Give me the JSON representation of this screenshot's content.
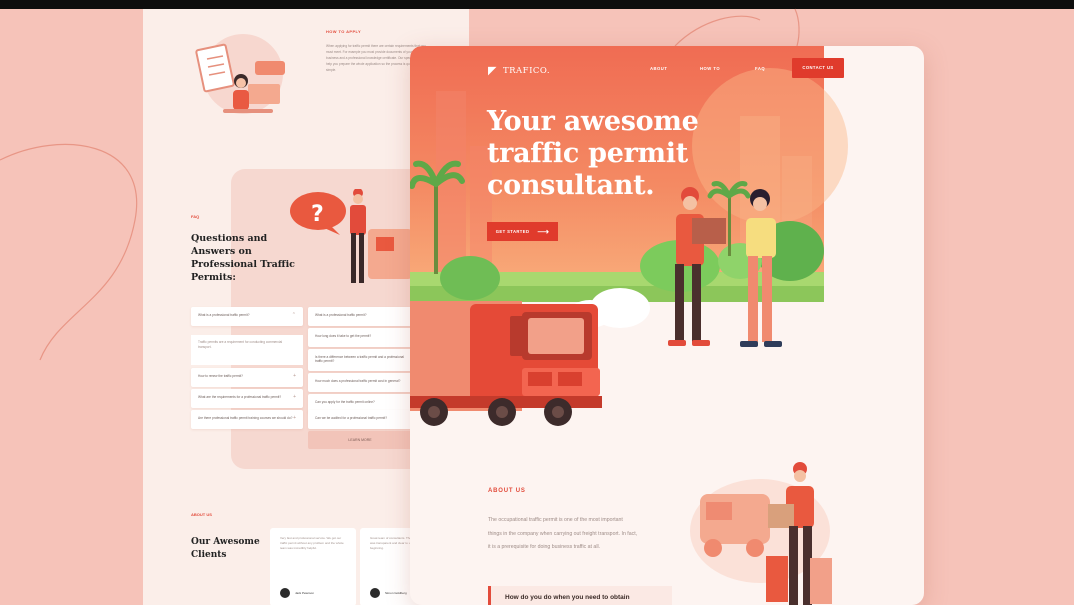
{
  "colors": {
    "accent": "#e03b2c",
    "hero_top": "#f06c53",
    "hero_bottom": "#f9b07d",
    "background": "#f6c3b9"
  },
  "back_page": {
    "howto_title": "HOW TO APPLY",
    "howto_text": "When applying for traffic permit there are certain requirements that you must meet. For example you must provide documents of your business and a professional knowledge certificate. Our specialists will help you prepare the whole application so the process is quick and simple.",
    "faq_tag": "FAQ",
    "faq_title": "Questions and Answers on Professional Traffic Permits:",
    "faq_questions_left": [
      "What is a professional traffic permit?",
      "How to renew the traffic permit?",
      "What are the requirements for a professional traffic permit?",
      "Are there professional traffic permit training courses we should do?"
    ],
    "faq_answer": "Traffic permits are a requirement for conducting commercial transport.",
    "faq_questions_right": [
      "What is a professional traffic permit?",
      "How long does it take to get the permit?",
      "Is there a difference between a traffic permit and a professional traffic permit?",
      "How much does a professional traffic permit cost in general?",
      "Can you apply for the traffic permit online?",
      "Can we be audited for a professional traffic permit?"
    ],
    "learn_more": "LEARN MORE",
    "about_tag": "ABOUT US",
    "clients_title": "Our Awesome Clients",
    "clients": [
      {
        "quote": "Very fast and professional service. We got our traffic permit without any problem and the whole team was incredibly helpful.",
        "name": "Jack Peterson"
      },
      {
        "quote": "Great team of consultants. The whole process was transparent and clear to us from the very beginning.",
        "name": "Simon Goldberg"
      }
    ]
  },
  "front_page": {
    "logo_mark": "◤",
    "logo_text": "TRAFICO.",
    "nav": [
      "ABOUT",
      "HOW TO",
      "FAQ"
    ],
    "contact_button": "CONTACT US",
    "hero_title": "Your awesome traffic permit consultant.",
    "cta_label": "GET STARTED",
    "cta_arrow": "⟶",
    "about_tag": "ABOUT US",
    "about_text": "The occupational traffic permit is one of the most important things in the company when carrying out freight transport. In fact, it is a prerequisite for doing business traffic at all.",
    "howdo_text": "How do you do when you need to obtain"
  }
}
